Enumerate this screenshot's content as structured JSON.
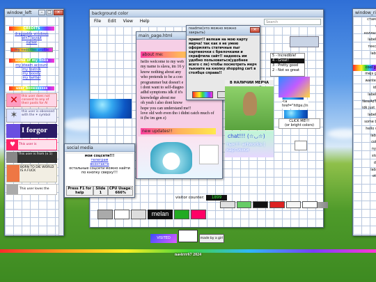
{
  "left_window": {
    "title": "window_left",
    "credits_header": "CREDITS",
    "credits_links": [
      "draggable windows",
      "win7 layout",
      "cursor"
    ],
    "neocities_link": "my neocities profile",
    "some_links_header": "some of my links",
    "some_links": [
      "my steam account",
      "my tostnik",
      "my boosty",
      "my twitter"
    ],
    "userboxes_header": "user boxessssss",
    "userboxes": [
      "this user does not consent to any of their posts for AI",
      "this user is obsessed with the ✶ symbol",
      "I forgor",
      "This user is AAAAAAAAAAAA",
      "This user is from (x 1)",
      "BORN TO DIE WORLD IS A FUCK",
      "This user loves the Nintendo"
    ]
  },
  "explorer_window": {
    "title": "background color",
    "menu": [
      "File",
      "Edit",
      "View",
      "Help"
    ],
    "search_placeholder": "Search",
    "stamps_label": "stamps"
  },
  "main_page": {
    "title": "main_page.html",
    "about_me_header": "about me:",
    "about_me_text": [
      "hello welcome to my web",
      "my name is slava, im 16 y",
      "know nothing about any",
      "who pretends to be a coo",
      "programmer but doesn't e",
      "i dont want to self-diagno",
      "adhd symptoms idk if it's",
      "knowledge about me",
      "oh yeah i also dont know",
      "hope you can understand me!!",
      "love old web even tho i didnt catch much of",
      "it (bc im gen z)"
    ],
    "new_updates_header": "new updates!!"
  },
  "readme_window": {
    "title": "readme(это можно можно закрыть)",
    "text": "привет!! велкам на мою карту мерча! так как я не умею оформлять статичные пыг картиночки с брелочками и скрафтила сайт!! надеюсь им удобно пользоваться(удобнее всего с пк) чтобы посмотреть мерч тыкните на кнопку shopping cart в столбце справа!!",
    "banner_text": "В НАЛИЧИИ МЕРЧА"
  },
  "chat_widget": {
    "chat_text": "chat!!! (☆◡☆)",
    "artworks_text": "тык!!! artworks | картинки"
  },
  "social_window": {
    "title": "social media",
    "header": "мои соцсети!!!",
    "links": [
      "телеграм",
      "вконтакте",
      "остальные соцсети можно найти по кнопку сверху!!!"
    ],
    "status": {
      "help_label": "Press F1 for help",
      "slide_label": "Slide",
      "slide_value": "1",
      "cpu_label": "CPU Usage:",
      "cpu_value": "666%"
    }
  },
  "right_panel": {
    "ratings": [
      "5 - Incredible!",
      "4 - Great!",
      "3 - Pretty good",
      "2 - Not so great"
    ],
    "code_text": "<a href=\"https://n",
    "click_label": "CLICK ME!!!",
    "click_sub": "(or bright colors)"
  },
  "right_window": {
    "title": "window_right",
    "labels": [
      "стамп",
      "м",
      "коллаж",
      "labels",
      "текст",
      "labe",
      "о",
      "cool gif",
      "mejs gr",
      "wanted",
      "idk",
      "labels",
      "NewAdTe",
      "idk just n",
      "labels",
      "some bl",
      "hello w",
      "labe",
      "cols",
      "nyo",
      "stol",
      "da",
      "labe",
      "otv"
    ]
  },
  "visitor": {
    "label": "visitor counter:",
    "digits": "1899"
  },
  "footer": {
    "made_by": "nastrrr67 2024",
    "badge_left": "VISITED",
    "badge_right": "made by a girl"
  }
}
